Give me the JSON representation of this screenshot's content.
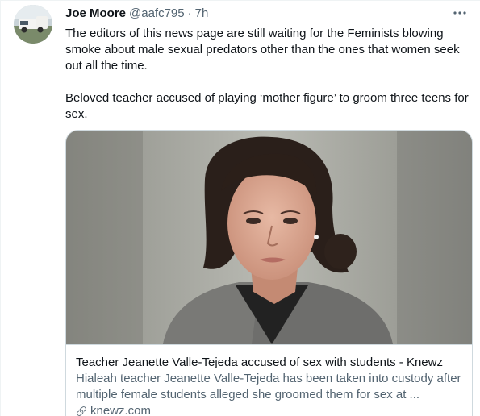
{
  "tweet": {
    "display_name": "Joe Moore",
    "handle": "@aafc795",
    "separator": "·",
    "time": "7h",
    "paragraphs": [
      "The editors of this news page are still waiting for the Feminists blowing smoke about male sexual predators other than the ones that women seek out all the time.",
      "Beloved teacher accused of playing ‘mother figure’ to groom three teens for sex."
    ],
    "more_icon": "ellipsis-icon"
  },
  "card": {
    "image_icon": "mugshot-photo",
    "title": "Teacher Jeanette Valle-Tejeda accused of sex with students - Knewz",
    "description": "Hialeah teacher Jeanette Valle-Tejeda has been taken into custody after multiple female students alleged she groomed them for sex at ...",
    "domain": "knewz.com",
    "domain_icon": "link-icon"
  },
  "colors": {
    "text_primary": "#0f1419",
    "text_secondary": "#536471",
    "border": "#cfd9de"
  }
}
